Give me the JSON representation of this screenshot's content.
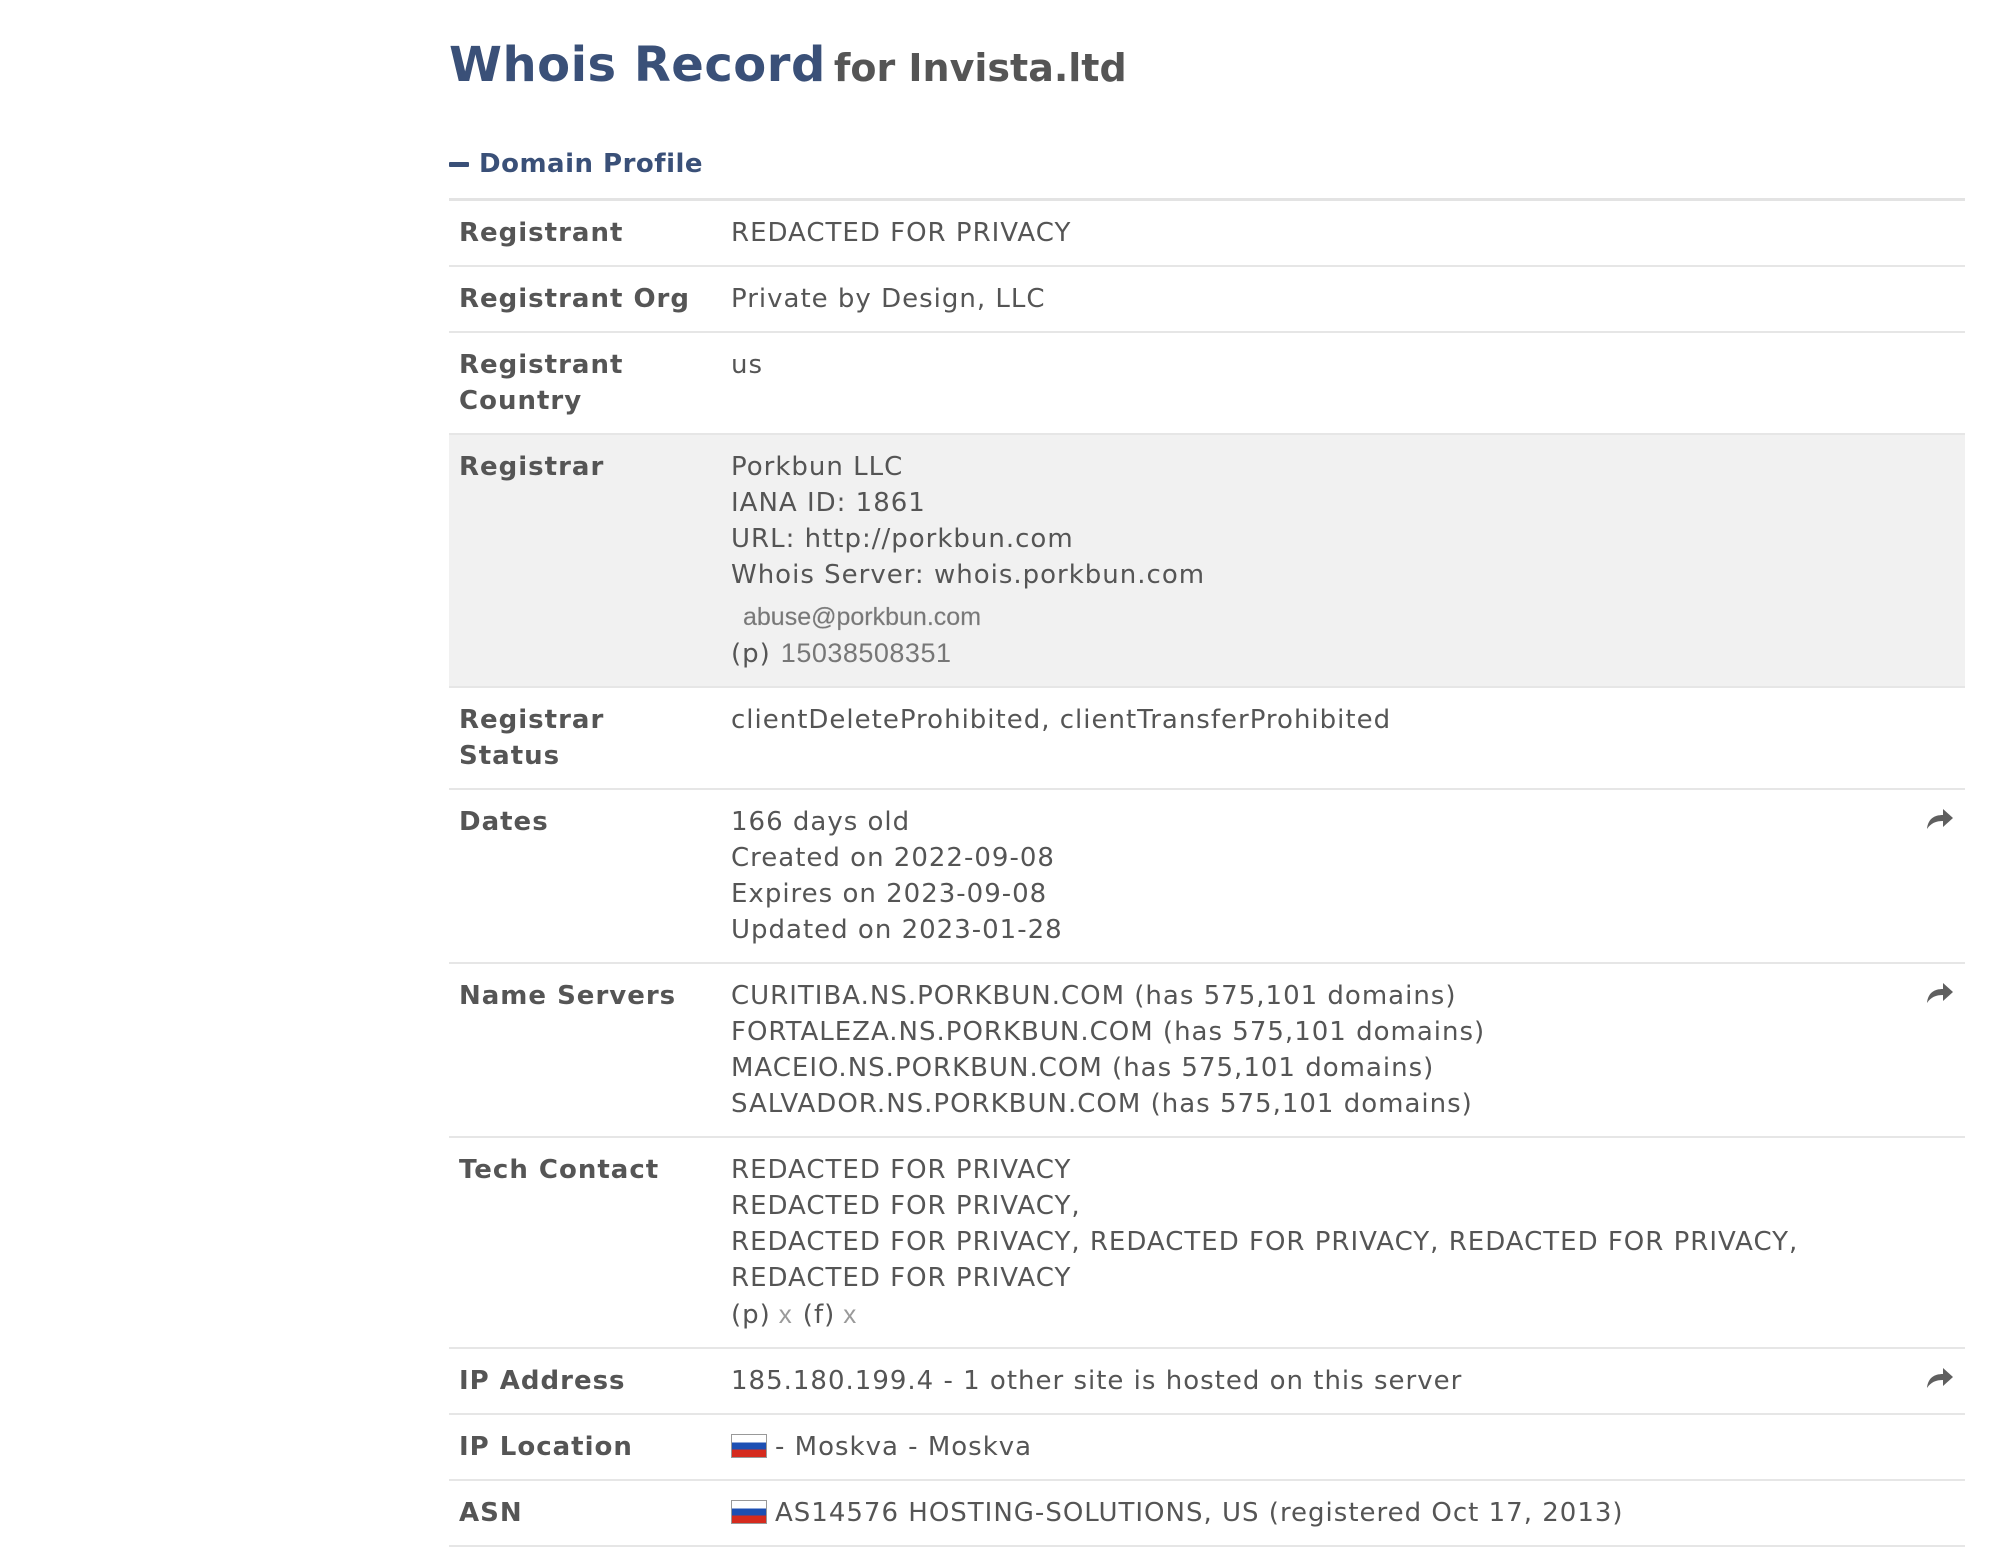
{
  "title": {
    "main": "Whois Record",
    "sub": "for Invista.ltd"
  },
  "section": {
    "label": "Domain Profile",
    "icon": "minus-collapse-icon"
  },
  "rows": {
    "registrant": {
      "label": "Registrant",
      "value": "REDACTED FOR PRIVACY"
    },
    "registrant_org": {
      "label": "Registrant Org",
      "value": "Private by Design, LLC"
    },
    "registrant_country": {
      "label": "Registrant Country",
      "value": "us"
    },
    "registrar": {
      "label": "Registrar",
      "name": "Porkbun LLC",
      "iana": "IANA ID: 1861",
      "url": "URL: http://porkbun.com",
      "whois_server": "Whois Server: whois.porkbun.com",
      "email": "abuse@porkbun.com",
      "phone_prefix": "(p)",
      "phone": "15038508351"
    },
    "registrar_status": {
      "label": "Registrar Status",
      "value": "clientDeleteProhibited, clientTransferProhibited"
    },
    "dates": {
      "label": "Dates",
      "age": "166 days old",
      "created": "Created on 2022-09-08",
      "expires": "Expires on 2023-09-08",
      "updated": "Updated on 2023-01-28"
    },
    "name_servers": {
      "label": "Name Servers",
      "servers": [
        "CURITIBA.NS.PORKBUN.COM (has 575,101 domains)",
        "FORTALEZA.NS.PORKBUN.COM (has 575,101 domains)",
        "MACEIO.NS.PORKBUN.COM (has 575,101 domains)",
        "SALVADOR.NS.PORKBUN.COM (has 575,101 domains)"
      ]
    },
    "tech_contact": {
      "label": "Tech Contact",
      "line1": "REDACTED FOR PRIVACY",
      "line2": "REDACTED FOR PRIVACY,",
      "line3": "REDACTED FOR PRIVACY, REDACTED FOR PRIVACY, REDACTED FOR PRIVACY, REDACTED FOR PRIVACY",
      "phone_prefix": "(p)",
      "phone_value": "x",
      "fax_prefix": "(f)",
      "fax_value": "x"
    },
    "ip_address": {
      "label": "IP Address",
      "value": "185.180.199.4 - 1 other site is hosted on this server"
    },
    "ip_location": {
      "label": "IP Location",
      "value": "- Moskva - Moskva",
      "flag": "russia-flag-icon"
    },
    "asn": {
      "label": "ASN",
      "value": "AS14576 HOSTING-SOLUTIONS, US (registered Oct 17, 2013)",
      "flag": "russia-flag-icon"
    }
  },
  "colors": {
    "title": "#3a5078",
    "text": "#555555",
    "shaded_row": "#f1f1f1",
    "divider": "#e6e6e6"
  },
  "icons": {
    "share": "share-arrow-icon"
  }
}
